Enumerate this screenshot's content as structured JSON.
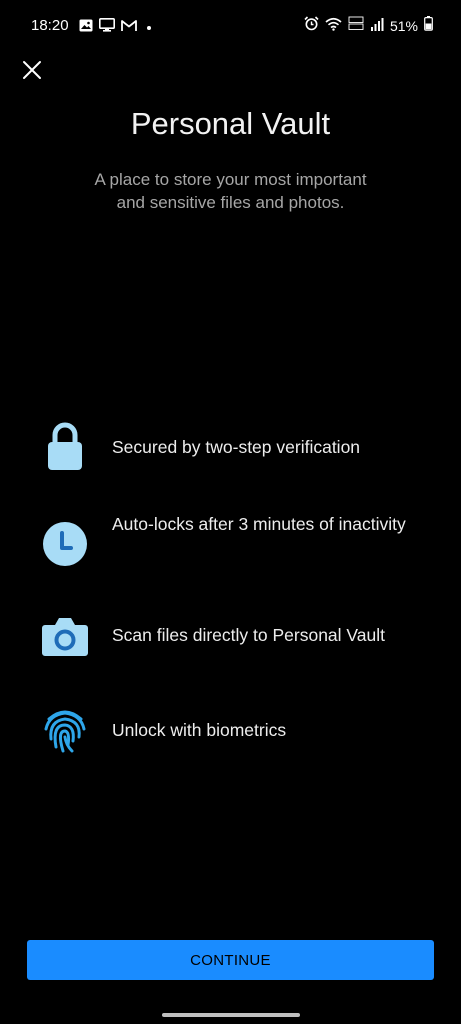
{
  "status_bar": {
    "time": "18:20",
    "battery_text": "51%",
    "left_icons": [
      "image-icon",
      "monitor-icon",
      "gmail-icon"
    ],
    "right_icons": [
      "alarm-icon",
      "wifi-icon",
      "volte-icon",
      "signal-icon",
      "battery-icon"
    ]
  },
  "header": {
    "close_icon": "close-icon",
    "title": "Personal Vault",
    "subtitle": "A place to store your most important and sensitive files and photos."
  },
  "features": [
    {
      "icon": "lock-icon",
      "text": "Secured by two-step verification"
    },
    {
      "icon": "clock-icon",
      "text": "Auto-locks after 3 minutes of inactivity"
    },
    {
      "icon": "camera-icon",
      "text": "Scan files directly to Personal Vault"
    },
    {
      "icon": "fingerprint-icon",
      "text": "Unlock with biometrics"
    }
  ],
  "actions": {
    "continue_label": "CONTINUE"
  },
  "colors": {
    "background": "#000000",
    "accent": "#1a8cff",
    "icon_light": "#a8dcf6",
    "fingerprint": "#2ea6ea"
  }
}
